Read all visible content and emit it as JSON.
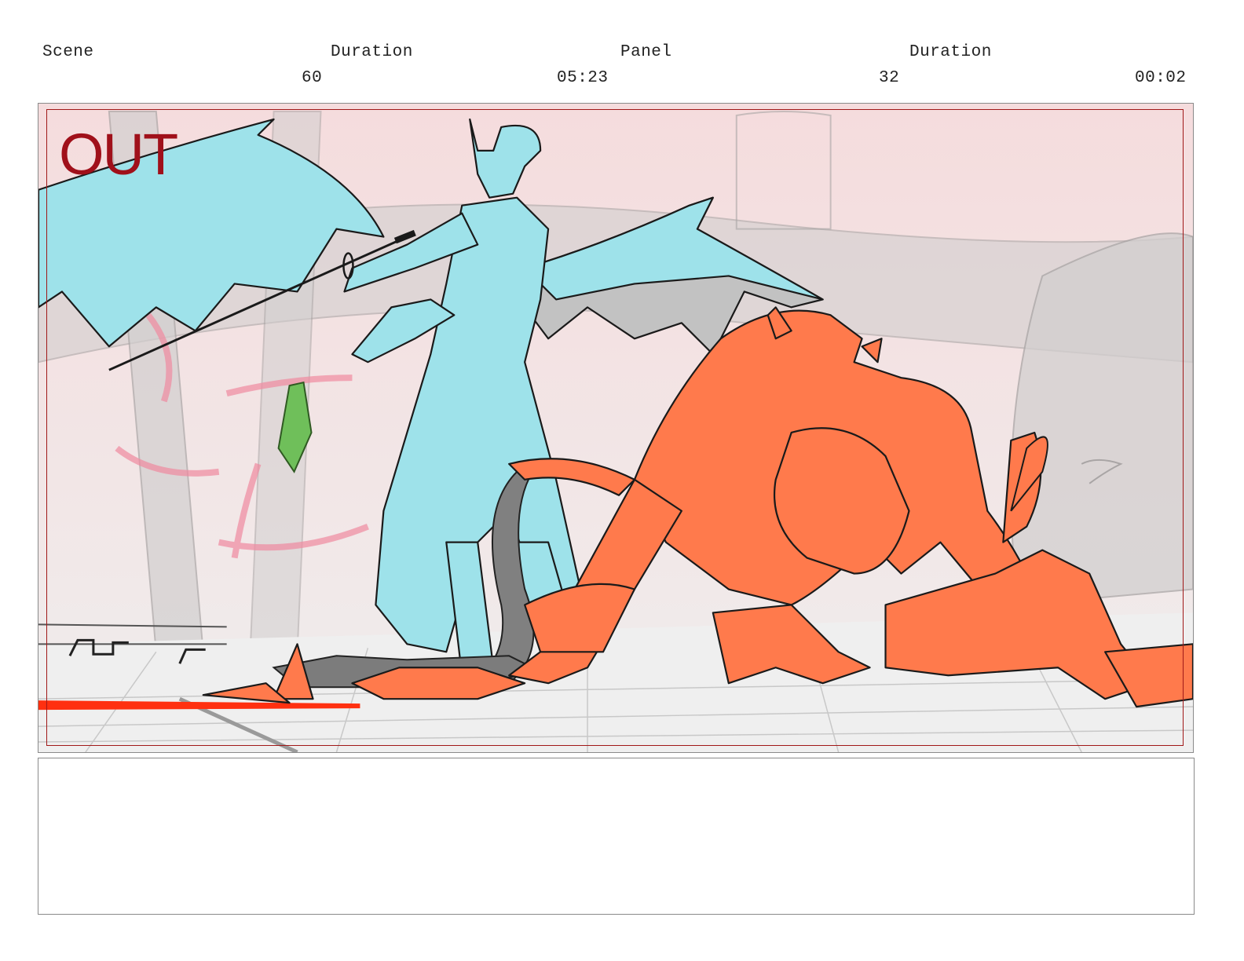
{
  "header": {
    "scene_label": "Scene",
    "scene_duration_label": "Duration",
    "panel_label": "Panel",
    "panel_duration_label": "Duration",
    "scene_number": "60",
    "scene_duration": "05:23",
    "panel_number": "32",
    "panel_duration": "00:02"
  },
  "panel": {
    "overlay_text": "OUT",
    "colors": {
      "sky": "#f3dfe0",
      "background_sketch": "#c9c6c6",
      "standing_figure": "#9ee2ea",
      "crouching_figure": "#ff7a4c",
      "sword_fragment": "#6fbf5a",
      "energy_streaks": "#f08aa0",
      "floor_slash": "#ff3010",
      "frame_border": "#a01818"
    }
  },
  "notes": {
    "text": ""
  }
}
